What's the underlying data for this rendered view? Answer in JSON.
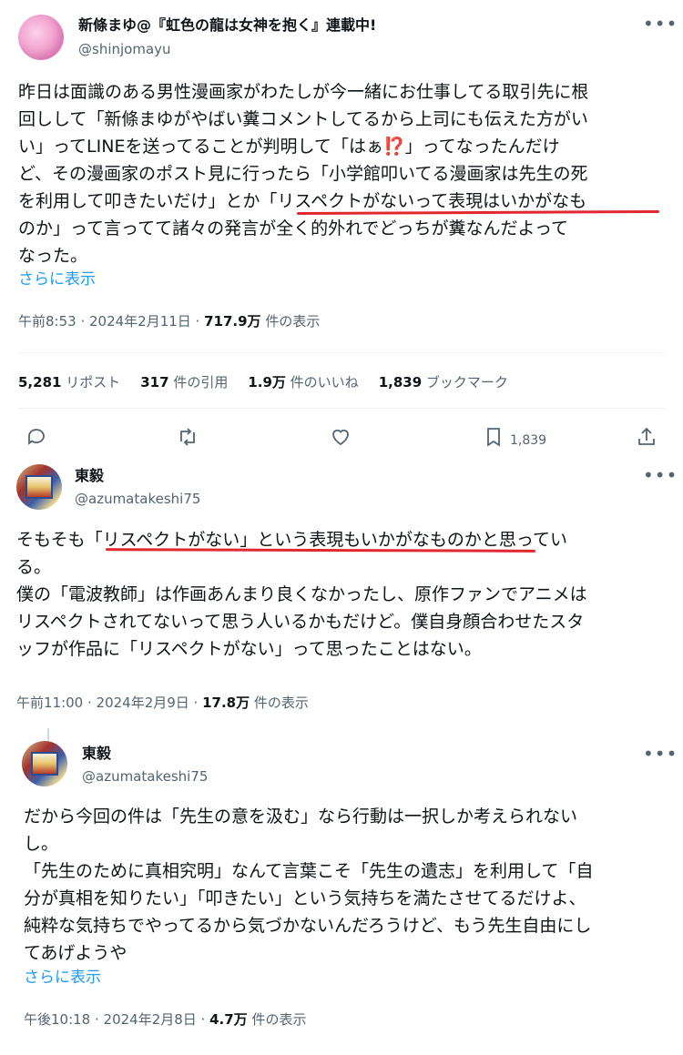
{
  "post1": {
    "name": "新條まゆ@『虹色の龍は女神を抱く』連載中!",
    "handle": "@shinjomayu",
    "text_a": "昨日は面識のある男性漫画家がわたしが今一緒にお仕事してる取引先に根\n回しして「新條まゆがやばい糞コメントしてるから上司にも伝えた方がい\nい」ってLINEを送ってることが判明して「はぁ",
    "emoji": "⁉️",
    "text_b": "」ってなったんだけ\nど、その漫画家のポスト見に行ったら「小学館叩いてる漫画家は先生の死\nを利用して叩きたいだけ」とか「リスペクトがないって表現はいかがなも\nのか」って言ってて諸々の発言が全く的外れでどっちが糞なんだよって\nなった。",
    "show_more": "さらに表示",
    "time": "午前8:53 · 2024年2月11日 · ",
    "views": "717.9万",
    "views_label": " 件の表示",
    "stats": {
      "reposts": "5,281",
      "reposts_label": " リポスト",
      "quotes": "317",
      "quotes_label": " 件の引用",
      "likes": "1.9万",
      "likes_label": " 件のいいね",
      "bookmarks": "1,839",
      "bookmarks_label": " ブックマーク"
    },
    "actions": {
      "bookmark_count": "1,839"
    }
  },
  "post2": {
    "name": "東毅",
    "handle": "@azumatakeshi75",
    "text": "そもそも「リスペクトがない」という表現もいかがなものかと思ってい\nる。\n僕の「電波教師」は作画あんまり良くなかったし、原作ファンでアニメは\nリスペクトされてないって思う人いるかもだけど。僕自身顔合わせたスタ\nッフが作品に「リスペクトがない」って思ったことはない。",
    "time": "午前11:00 · 2024年2月9日 · ",
    "views": "17.8万",
    "views_label": " 件の表示"
  },
  "post3": {
    "name": "東毅",
    "handle": "@azumatakeshi75",
    "text": "だから今回の件は「先生の意を汲む」なら行動は一択しか考えられない\nし。\n「先生のために真相究明」なんて言葉こそ「先生の遺志」を利用して「自\n分が真相を知りたい」「叩きたい」という気持ちを満たさせてるだけよ、\n純粋な気持ちでやってるから気づかないんだろうけど、もう先生自由にし\nてあげようや",
    "show_more": "さらに表示",
    "time": "午後10:18 · 2024年2月8日 · ",
    "views": "4.7万",
    "views_label": " 件の表示"
  },
  "colors": {
    "accent": "#1d9bf0",
    "highlight": "#e0282e",
    "muted": "#536471"
  },
  "icons": [
    "reply-icon",
    "repost-icon",
    "like-icon",
    "bookmark-icon",
    "share-icon",
    "more-icon"
  ]
}
